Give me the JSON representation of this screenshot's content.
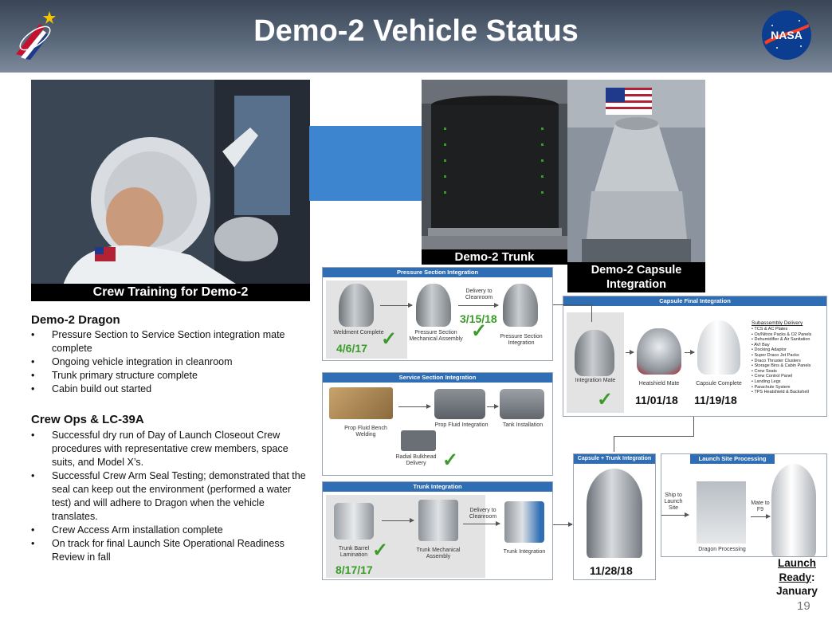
{
  "header": {
    "title": "Demo-2 Vehicle Status"
  },
  "captions": {
    "crew_training": "Crew Training for Demo-2",
    "trunk": "Demo-2 Trunk",
    "capsule": "Demo-2 Capsule Integration"
  },
  "dragon": {
    "heading": "Demo-2 Dragon",
    "items": [
      "Pressure Section to Service Section integration mate complete",
      "Ongoing vehicle integration in cleanroom",
      "Trunk primary structure complete",
      "Cabin build out started"
    ]
  },
  "crew_ops": {
    "heading": "Crew Ops & LC-39A",
    "items": [
      "Successful dry run of Day of Launch Closeout Crew procedures with representative crew members, space suits, and Model X’s.",
      "Successful Crew Arm Seal Testing; demonstrated that the seal can keep out the environment (performed a water test) and will adhere to Dragon when the vehicle translates.",
      "Crew Access Arm installation complete",
      "On track for final Launch Site Operational Readiness Review in fall"
    ]
  },
  "pressure": {
    "title": "Pressure Section Integration",
    "weldment": "Weldment Complete",
    "mech": "Pressure Section Mechanical Assembly",
    "delivery": "Delivery to Cleanroom",
    "integration": "Pressure Section Integration",
    "date1": "4/6/17",
    "date2": "3/15/18"
  },
  "service": {
    "title": "Service Section Integration",
    "bench": "Prop Fluid Bench Welding",
    "prop": "Prop Fluid Integration",
    "tank": "Tank Installation",
    "bulkhead": "Radial Bulkhead Delivery"
  },
  "trunk_int": {
    "title": "Trunk Integration",
    "barrel": "Trunk Barrel Lamination",
    "mech": "Trunk Mechanical Assembly",
    "delivery": "Delivery to Cleanroom",
    "integration": "Trunk Integration",
    "date": "8/17/17"
  },
  "capsule_final": {
    "title": "Capsule Final Integration",
    "integration_mate": "Integration Mate",
    "heatshield": "Heatshield Mate",
    "complete": "Capsule Complete",
    "date1": "11/01/18",
    "date2": "11/19/18",
    "sub_heading": "Subassembly Delivery",
    "sub_items": [
      "TCS & AC Plates",
      "Ox/Nitrox Packs & O2 Panels",
      "Dehumidifier & Air Sanitation",
      "AVI Bay",
      "Docking Adaptor",
      "Super Draco Jet Packs",
      "Draco Thruster Clusters",
      "Storage Bins & Cabin Panels",
      "Crew Seats",
      "Crew Control Panel",
      "Landing Legs",
      "Parachute System",
      "TPS Heatshield & Backshell"
    ]
  },
  "capsule_trunk": {
    "title": "Capsule + Trunk Integration",
    "date": "11/28/18"
  },
  "launch_site": {
    "title": "Launch Site Processing",
    "ship": "Ship to Launch Site",
    "dragon": "Dragon Processing",
    "mate": "Mate to F9",
    "launch": "Launch",
    "ready": "Ready",
    "colon": ":",
    "month": "January"
  },
  "page_number": "19"
}
